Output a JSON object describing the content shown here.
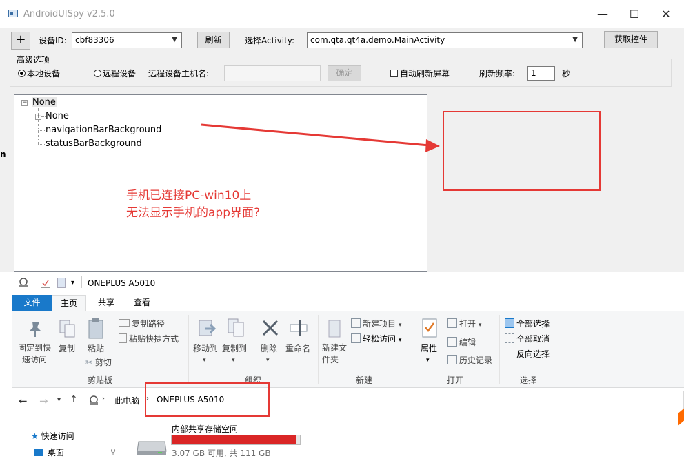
{
  "spy": {
    "title": "AndroidUISpy v2.5.0",
    "window_controls": {
      "minimize": "—",
      "maximize": "☐",
      "close": "✕"
    },
    "add_button": "+",
    "device_id_label": "设备ID:",
    "device_id_value": "cbf83306",
    "refresh_button": "刷新",
    "activity_label": "选择Activity:",
    "activity_value": "com.qta.qt4a.demo.MainActivity",
    "get_controls_button": "获取控件",
    "advanced_group": "高级选项",
    "radio_local": "本地设备",
    "radio_remote": "远程设备",
    "remote_host_label": "远程设备主机名:",
    "remote_host_value": "",
    "confirm_button": "确定",
    "auto_refresh_label": "自动刷新屏幕",
    "auto_refresh_checked": false,
    "refresh_rate_label": "刷新频率:",
    "refresh_rate_value": "1",
    "refresh_rate_unit": "秒",
    "tree": {
      "root": "None",
      "children": [
        "None",
        "navigationBarBackground",
        "statusBarBackground"
      ]
    },
    "annotation_line1": "手机已连接PC-win10上",
    "annotation_line2": "无法显示手机的app界面?",
    "annotation_color": "#e53935"
  },
  "explorer": {
    "title": "ONEPLUS A5010",
    "tabs": [
      "文件",
      "主页",
      "共享",
      "查看"
    ],
    "active_tab": "主页",
    "clipboard": {
      "pin": "固定到快速访问",
      "copy": "复制",
      "paste": "粘贴",
      "copy_path": "复制路径",
      "paste_shortcut": "粘贴快捷方式",
      "cut": "剪切",
      "group": "剪贴板"
    },
    "organize": {
      "move_to": "移动到",
      "copy_to": "复制到",
      "delete": "删除",
      "rename": "重命名",
      "group": "组织"
    },
    "new": {
      "new_item": "新建项目",
      "easy_access": "轻松访问",
      "new_folder": "新建文件夹",
      "group": "新建"
    },
    "open": {
      "properties": "属性",
      "open": "打开",
      "edit": "编辑",
      "history": "历史记录",
      "group": "打开"
    },
    "select": {
      "select_all": "全部选择",
      "select_none": "全部取消",
      "invert": "反向选择",
      "group": "选择"
    },
    "nav": {
      "this_pc": "此电脑",
      "current": "ONEPLUS A5010"
    },
    "sidebar": [
      "快速访问",
      "桌面"
    ],
    "storage": {
      "name": "内部共享存储空间",
      "used_fraction": 0.972,
      "summary": "3.07 GB 可用, 共 111 GB",
      "bar_color": "#da2626"
    }
  }
}
